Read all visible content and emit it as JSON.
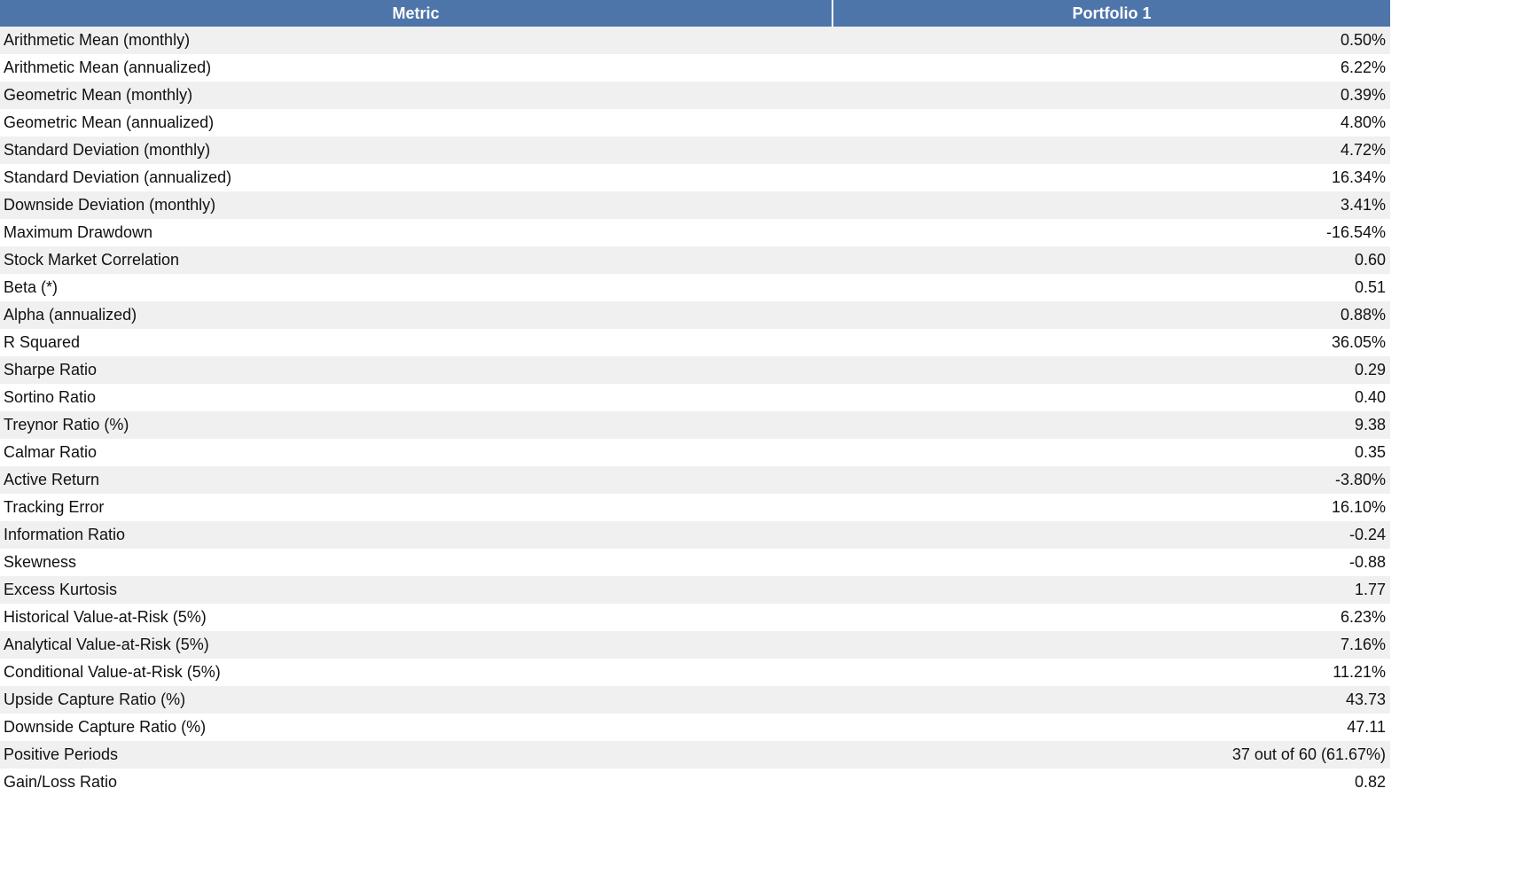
{
  "table": {
    "headers": [
      "Metric",
      "Portfolio 1"
    ],
    "rows": [
      [
        "Arithmetic Mean (monthly)",
        "0.50%"
      ],
      [
        "Arithmetic Mean (annualized)",
        "6.22%"
      ],
      [
        "Geometric Mean (monthly)",
        "0.39%"
      ],
      [
        "Geometric Mean (annualized)",
        "4.80%"
      ],
      [
        "Standard Deviation (monthly)",
        "4.72%"
      ],
      [
        "Standard Deviation (annualized)",
        "16.34%"
      ],
      [
        "Downside Deviation (monthly)",
        "3.41%"
      ],
      [
        "Maximum Drawdown",
        "-16.54%"
      ],
      [
        "Stock Market Correlation",
        "0.60"
      ],
      [
        "Beta (*)",
        "0.51"
      ],
      [
        "Alpha (annualized)",
        "0.88%"
      ],
      [
        "R Squared",
        "36.05%"
      ],
      [
        "Sharpe Ratio",
        "0.29"
      ],
      [
        "Sortino Ratio",
        "0.40"
      ],
      [
        "Treynor Ratio (%)",
        "9.38"
      ],
      [
        "Calmar Ratio",
        "0.35"
      ],
      [
        "Active Return",
        "-3.80%"
      ],
      [
        "Tracking Error",
        "16.10%"
      ],
      [
        "Information Ratio",
        "-0.24"
      ],
      [
        "Skewness",
        "-0.88"
      ],
      [
        "Excess Kurtosis",
        "1.77"
      ],
      [
        "Historical Value-at-Risk (5%)",
        "6.23%"
      ],
      [
        "Analytical Value-at-Risk (5%)",
        "7.16%"
      ],
      [
        "Conditional Value-at-Risk (5%)",
        "11.21%"
      ],
      [
        "Upside Capture Ratio (%)",
        "43.73"
      ],
      [
        "Downside Capture Ratio (%)",
        "47.11"
      ],
      [
        "Positive Periods",
        "37 out of 60 (61.67%)"
      ],
      [
        "Gain/Loss Ratio",
        "0.82"
      ]
    ]
  }
}
